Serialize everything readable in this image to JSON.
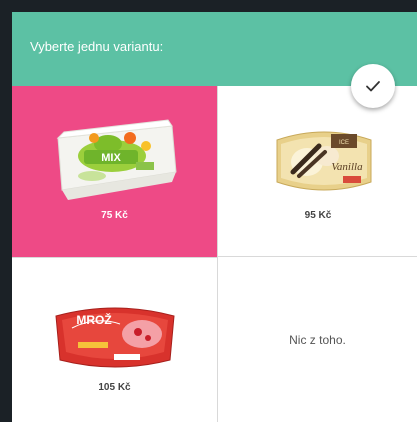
{
  "header": {
    "title": "Vyberte jednu variantu:",
    "color": "#5cc1a4"
  },
  "confirm_button": {
    "icon": "check-icon"
  },
  "options": [
    {
      "price": "75 Kč",
      "image": "mix-ice-cream-tub-image",
      "selected": true,
      "highlight_color": "#ee4a86"
    },
    {
      "price": "95 Kč",
      "image": "vanilla-ice-cream-box-image",
      "selected": false
    },
    {
      "price": "105 Kč",
      "image": "mrož-ice-cream-tub-image",
      "selected": false
    },
    {
      "label": "Nic z toho.",
      "selected": false
    }
  ]
}
